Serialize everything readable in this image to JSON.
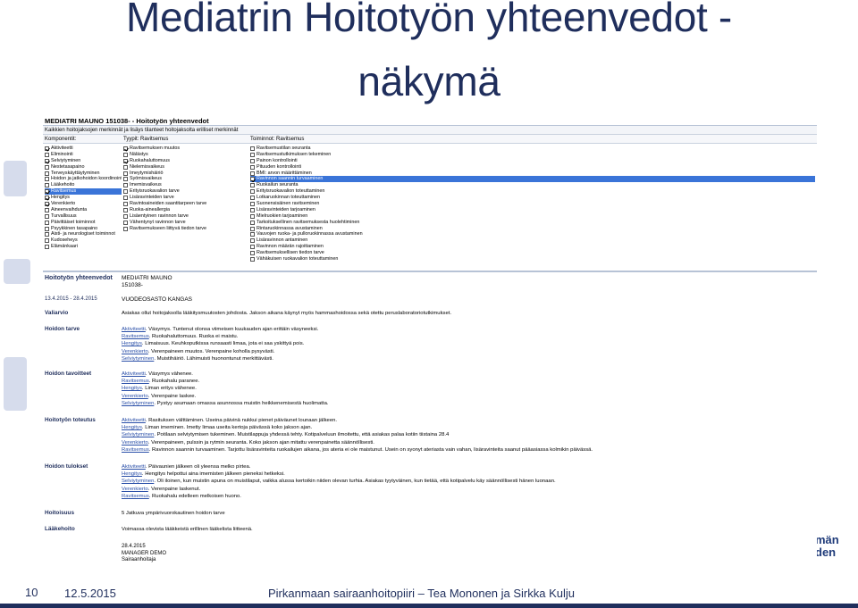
{
  "slide": {
    "title_line1": "Mediatrin Hoitotyön yhteenvedot -",
    "title_line2": "näkymä",
    "page_number": "10",
    "date": "12.5.2015",
    "organization": "Pirkanmaan sairaanhoitopiiri – Tea Mononen ja Sirkka Kulju",
    "logo_fragment_1": "män",
    "logo_fragment_2": "den"
  },
  "window": {
    "title": "MEDIATRI MAUNO 151038- - Hoitotyön yhteenvedot",
    "menu": "Kaikkien hoitojaksojen merkinnät ja lisäys tilanteet hoitojaksolta erilliset merkinnät",
    "col_headers": {
      "components": "Komponentit:",
      "types": "Tyypit: Ravitsemus",
      "actions": "Toiminnot: Ravitsemus"
    },
    "components": [
      {
        "label": "Aktiviteetti",
        "checked": true,
        "selected": false
      },
      {
        "label": "Eliminointi",
        "checked": false,
        "selected": false
      },
      {
        "label": "Selviytyminen",
        "checked": true,
        "selected": false
      },
      {
        "label": "Nestetasapaino",
        "checked": false,
        "selected": false
      },
      {
        "label": "Terveyskäyttäytyminen",
        "checked": false,
        "selected": false
      },
      {
        "label": "Hoidon ja jatkohoidon koordinointi",
        "checked": false,
        "selected": false
      },
      {
        "label": "Lääkehoito",
        "checked": false,
        "selected": false
      },
      {
        "label": "Ravitsemus",
        "checked": true,
        "selected": true
      },
      {
        "label": "Hengitys",
        "checked": true,
        "selected": false
      },
      {
        "label": "Verenkierto",
        "checked": true,
        "selected": false
      },
      {
        "label": "Aineenvaihdunta",
        "checked": false,
        "selected": false
      },
      {
        "label": "Turvallisuus",
        "checked": false,
        "selected": false
      },
      {
        "label": "Päivittäiset toiminnot",
        "checked": false,
        "selected": false
      },
      {
        "label": "Psyykkinen tasapaino",
        "checked": false,
        "selected": false
      },
      {
        "label": "Aisti- ja neurologiset toiminnot",
        "checked": false,
        "selected": false
      },
      {
        "label": "Kudoseheys",
        "checked": false,
        "selected": false
      },
      {
        "label": "Elämänkaari",
        "checked": false,
        "selected": false
      }
    ],
    "types": [
      {
        "label": "Ravitsemuksen muutos",
        "checked": true
      },
      {
        "label": "Nälästys",
        "checked": false
      },
      {
        "label": "Ruokahaluttomuus",
        "checked": true
      },
      {
        "label": "Nielemisvaikeus",
        "checked": false
      },
      {
        "label": "Imeytymishäiriö",
        "checked": false
      },
      {
        "label": "Syömisvaikeus",
        "checked": false
      },
      {
        "label": "Imemisvaikeus",
        "checked": false
      },
      {
        "label": "Erityisruokavalion tarve",
        "checked": false
      },
      {
        "label": "Lisäravinteiden tarve",
        "checked": false
      },
      {
        "label": "Ravintoaineiden saantitarpeen tarve",
        "checked": false
      },
      {
        "label": "Ruoka-aineallergia",
        "checked": false
      },
      {
        "label": "Lisäentyinen ravinnon tarve",
        "checked": false
      },
      {
        "label": "Vähentynyt ravinnon tarve",
        "checked": false
      },
      {
        "label": "Ravitsemukseen liittyvä tiedon tarve",
        "checked": false
      }
    ],
    "actions": [
      {
        "label": "Ravitsemustilan seuranta",
        "checked": false,
        "selected": false
      },
      {
        "label": "Ravitsemustutkimuksen tekeminen",
        "checked": false,
        "selected": false
      },
      {
        "label": "Painon kontrollointi",
        "checked": false,
        "selected": false
      },
      {
        "label": "Pituuden kontrollointi",
        "checked": false,
        "selected": false
      },
      {
        "label": "BMI: arvon määrittäminen",
        "checked": false,
        "selected": false
      },
      {
        "label": "Ravinnon saannin turvaaminen",
        "checked": true,
        "selected": true
      },
      {
        "label": "Ruokailun seuranta",
        "checked": false,
        "selected": false
      },
      {
        "label": "Erityisruokavalion toteuttaminen",
        "checked": false,
        "selected": false
      },
      {
        "label": "Lotkaruokinnan toteuttaminen",
        "checked": false,
        "selected": false
      },
      {
        "label": "Suonensisäinen ravitseminen",
        "checked": false,
        "selected": false
      },
      {
        "label": "Lisäravinteiden tarjoaminen",
        "checked": false,
        "selected": false
      },
      {
        "label": "Mielruokien tarjoaminen",
        "checked": false,
        "selected": false
      },
      {
        "label": "Tarkoituksellinen ravitsemuksesta huolehtiminen",
        "checked": false,
        "selected": false
      },
      {
        "label": "Rintaruokinnassa avustaminen",
        "checked": false,
        "selected": false
      },
      {
        "label": "Vauvojen ruoka- ja pulloruokinnassa avustaminen",
        "checked": false,
        "selected": false
      },
      {
        "label": "Lisäravinnon antaminen",
        "checked": false,
        "selected": false
      },
      {
        "label": "Ravinnon määrän rajoittaminen",
        "checked": false,
        "selected": false
      },
      {
        "label": "Ravitsemuksellisen tiedon tarve",
        "checked": false,
        "selected": false
      },
      {
        "label": "Vähäkuisen ruokavalion toteuttaminen",
        "checked": false,
        "selected": false
      }
    ]
  },
  "summary": {
    "heading": "Hoitotyön yhteenvedot",
    "period": "13.4.2015 - 28.4.2015",
    "patient_name": "MEDIATRI MAUNO",
    "patient_id": "151038-",
    "ward": "VUODEOSASTO KANGAS",
    "sections": [
      {
        "label": "Valiarvio",
        "lines": [
          [
            {
              "t": "",
              "term": false
            },
            {
              "t": "Asiakas ollut hoitojaksolla lääkitysmuutosten johdosta. Jakson aikana käynyt myös hammashoidossa sekä otettu peruslaboratoriotutkimukset.",
              "term": false
            }
          ]
        ]
      },
      {
        "label": "Hoidon tarve",
        "lines": [
          [
            {
              "t": "Aktiviteetti",
              "term": true
            },
            {
              "t": ". Väsymys. Tuntenut olonsa viimeisen kuukauden ajan erittäin väsyneeksi.",
              "term": false
            }
          ],
          [
            {
              "t": "Ravitsemus",
              "term": true
            },
            {
              "t": ". Ruokahaluttomuus. Ruoka ei maistu.",
              "term": false
            }
          ],
          [
            {
              "t": "Hengitys",
              "term": true
            },
            {
              "t": ". Limaisuus. Keuhkoputkissa runsaasti limaa, jota ei saa yskittyä pois.",
              "term": false
            }
          ],
          [
            {
              "t": "Verenkierto",
              "term": true
            },
            {
              "t": ". Verenpaineen muutos. Verenpaine koholla pysyvästi.",
              "term": false
            }
          ],
          [
            {
              "t": "Selviytyminen",
              "term": true
            },
            {
              "t": ". Muistihäiriö. Lähimuisti huonontunut merkittävästi.",
              "term": false
            }
          ]
        ]
      },
      {
        "label": "Hoidon tavoitteet",
        "lines": [
          [
            {
              "t": "Aktiviteetti",
              "term": true
            },
            {
              "t": ". Väsymys vähenee.",
              "term": false
            }
          ],
          [
            {
              "t": "Ravitsemus",
              "term": true
            },
            {
              "t": ". Ruokahalu paranee.",
              "term": false
            }
          ],
          [
            {
              "t": "Hengitys",
              "term": true
            },
            {
              "t": ". Liman eritys vähenee.",
              "term": false
            }
          ],
          [
            {
              "t": "Verenkierto",
              "term": true
            },
            {
              "t": ". Verenpaine laskee.",
              "term": false
            }
          ],
          [
            {
              "t": "Selviytyminen",
              "term": true
            },
            {
              "t": ". Pystyy asumaan omassa asunnossa muistin heikkenemisestä huolimatta.",
              "term": false
            }
          ]
        ]
      },
      {
        "label": "Hoitotyön toteutus",
        "lines": [
          [
            {
              "t": "Aktiviteetti",
              "term": true
            },
            {
              "t": ". Rasituksen välttäminen. Useina päivinä nukkui pienet päiväunet lounaan jälkeen.",
              "term": false
            }
          ],
          [
            {
              "t": "Hengitys",
              "term": true
            },
            {
              "t": ". Liman imeminen. Imetty limaa useita kertoja päivässä koko jakson ajan.",
              "term": false
            }
          ],
          [
            {
              "t": "Selviytyminen",
              "term": true
            },
            {
              "t": ". Potilaan selviytymisen tukeminen. Muistilappuja yhdessä tehty. Kotipalveluun ilmoitettu, että asiakas palaa kotiin tiistaina 28.4",
              "term": false
            }
          ],
          [
            {
              "t": "Verenkierto",
              "term": true
            },
            {
              "t": ". Verenpaineen, pulssin ja rytmin seuranta. Koko jakson ajan mitattu verenpainetta säännöllisesti.",
              "term": false
            }
          ],
          [
            {
              "t": "Ravitsemus",
              "term": true
            },
            {
              "t": ". Ravinnon saannin turvaaminen. Tarjottu lisäravinteita ruokailujen aikana, jos ateria ei ole maistunut. Usein on syonyt ateriasta vain vahan, lisäravinteita saanut pääasiassa kolmikin päivässä.",
              "term": false
            }
          ]
        ]
      },
      {
        "label": "Hoidon tulokset",
        "lines": [
          [
            {
              "t": "Aktiviteetti",
              "term": true
            },
            {
              "t": ". Päivaunien jälkeen oli yleensa melko pirtea.",
              "term": false
            }
          ],
          [
            {
              "t": "Hengitys",
              "term": true
            },
            {
              "t": ". Hengitys helpottui aina imemisten jälkeen pieneksi hetkeksi.",
              "term": false
            }
          ],
          [
            {
              "t": "Selviytyminen",
              "term": true
            },
            {
              "t": ". Oli iloinen, kun muistin apuna on muistilaput, vaikka alussa kertoikin niiden olevan turhia. Asiakas tyytyväinen, kun tietää, että kotipalvelu käy säännöllisesti hänen luonaan.",
              "term": false
            }
          ],
          [
            {
              "t": "Verenkierto",
              "term": true
            },
            {
              "t": ". Verenpaine laskenut.",
              "term": false
            }
          ],
          [
            {
              "t": "Ravitsemus",
              "term": true
            },
            {
              "t": ". Ruokahalu edelleen melkoisen huono.",
              "term": false
            }
          ]
        ]
      },
      {
        "label": "Hoitoisuus",
        "lines": [
          [
            {
              "t": "",
              "term": false
            },
            {
              "t": "5 Jatkuva ympärivuorokautinen hoidon tarve",
              "term": false
            }
          ]
        ]
      },
      {
        "label": "Lääkehoito",
        "lines": [
          [
            {
              "t": "",
              "term": false
            },
            {
              "t": "Voimassa olevista lääkkeistä erillinen lääkelista liitteenä.",
              "term": false
            }
          ]
        ]
      }
    ],
    "signature": {
      "date": "28.4.2015",
      "name": "MANAGER DEMO",
      "role": "Sairaanhoitaja"
    }
  }
}
